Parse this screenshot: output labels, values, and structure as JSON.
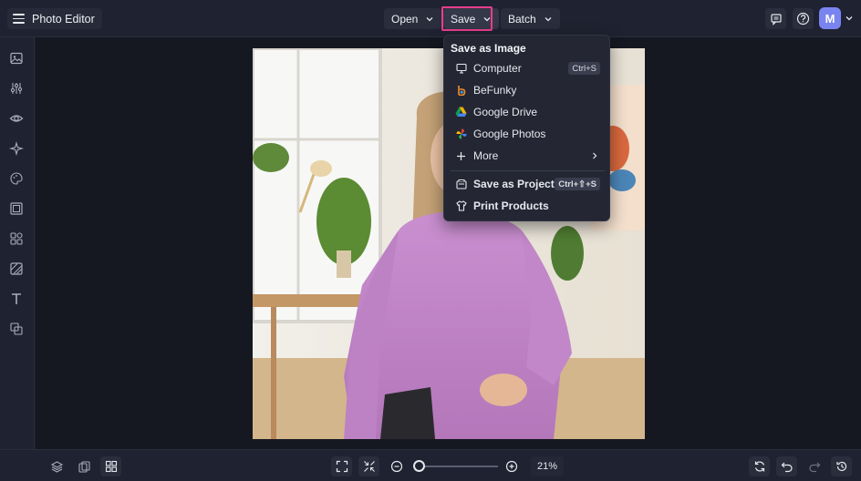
{
  "app": {
    "title": "Photo Editor"
  },
  "toolbar": {
    "open_label": "Open",
    "save_label": "Save",
    "batch_label": "Batch"
  },
  "user": {
    "avatar_initial": "M"
  },
  "save_menu": {
    "heading": "Save as Image",
    "items": [
      {
        "label": "Computer",
        "shortcut": "Ctrl+S",
        "icon": "monitor-icon"
      },
      {
        "label": "BeFunky",
        "icon": "befunky-logo-icon"
      },
      {
        "label": "Google Drive",
        "icon": "google-drive-icon"
      },
      {
        "label": "Google Photos",
        "icon": "google-photos-icon"
      },
      {
        "label": "More",
        "icon": "plus-icon"
      }
    ],
    "project": {
      "label": "Save as Project",
      "shortcut": "Ctrl+⇧+S"
    },
    "print": {
      "label": "Print Products"
    }
  },
  "zoom": {
    "value": "21%",
    "fraction": 0.04
  },
  "colors": {
    "accent_highlight": "#e83e8c",
    "avatar": "#7a84f0",
    "background": "#1b1d27"
  }
}
